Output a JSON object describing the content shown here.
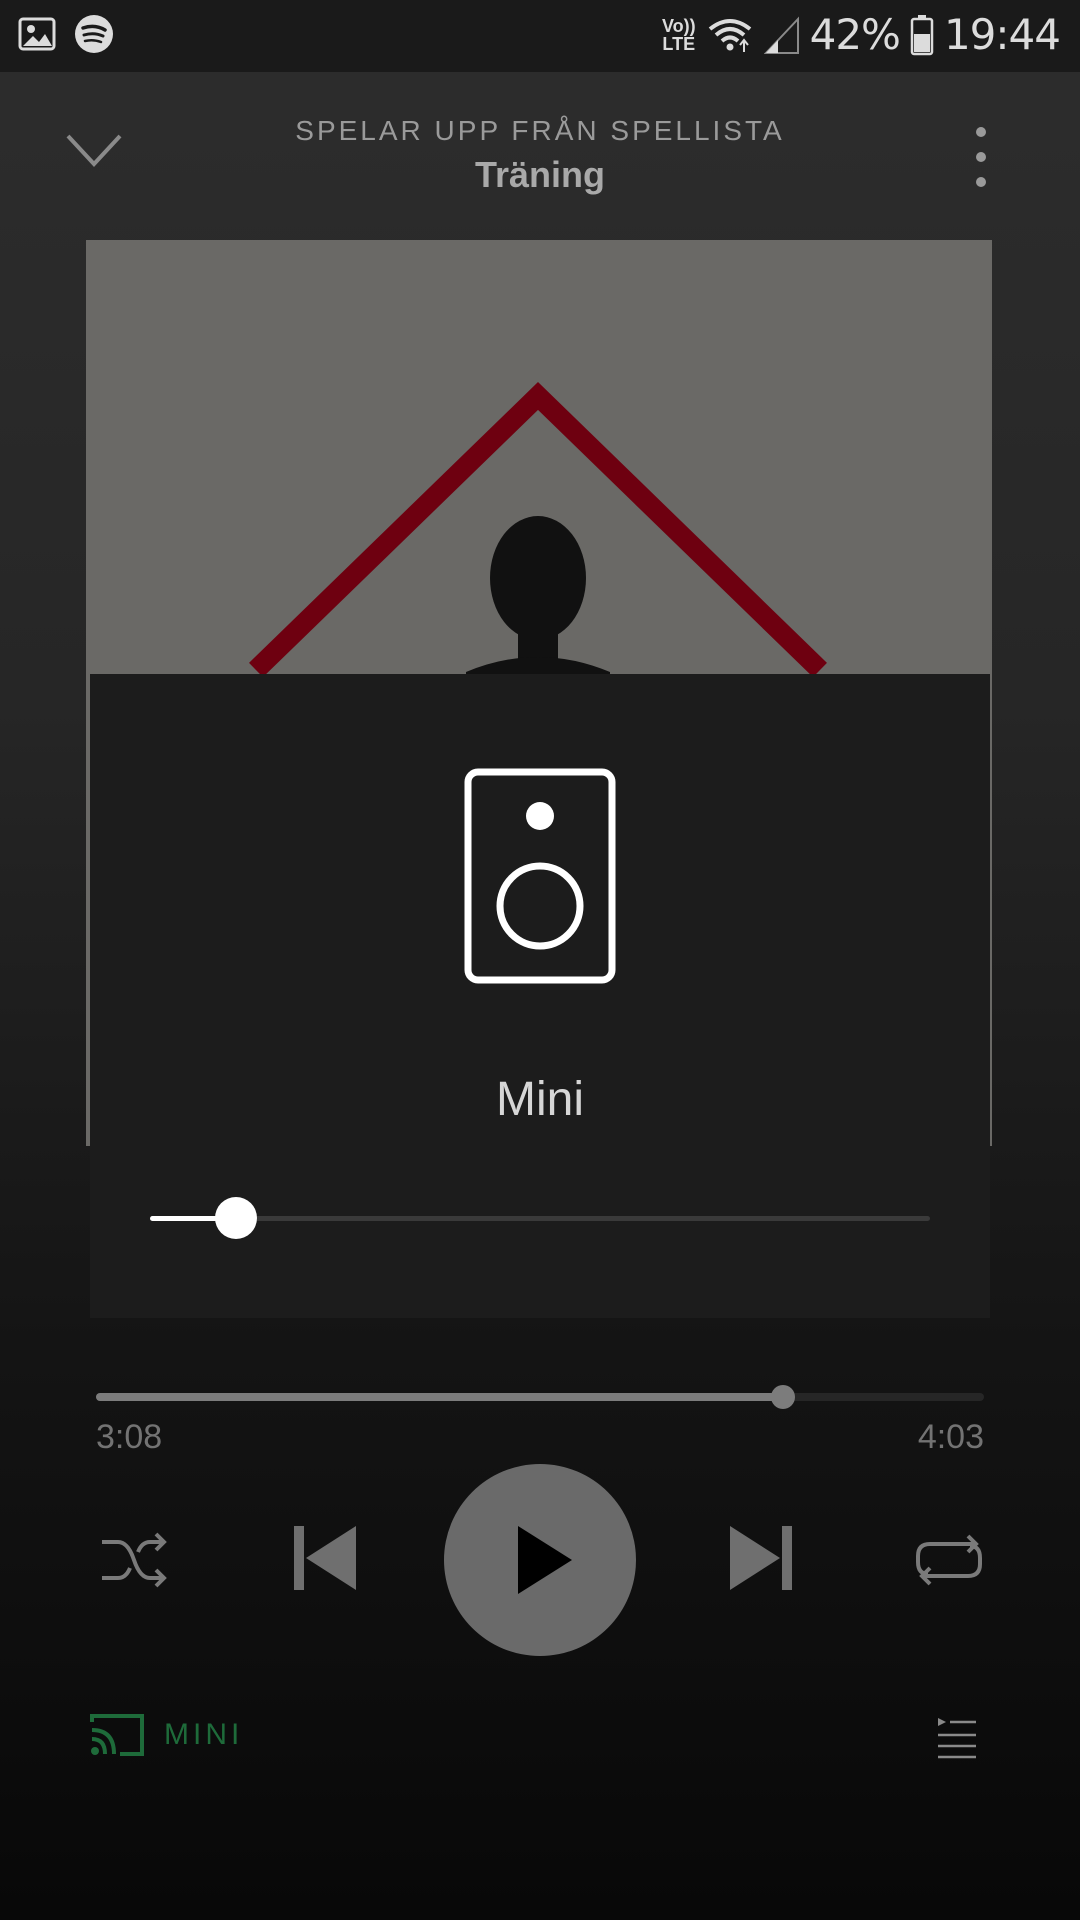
{
  "status_bar": {
    "battery": "42%",
    "time": "19:44",
    "volte_line1": "Vo))",
    "volte_line2": "LTE",
    "icons": [
      "image-icon",
      "spotify-icon",
      "volte-icon",
      "wifi-icon",
      "signal-icon",
      "battery-icon"
    ]
  },
  "header": {
    "context_label": "SPELAR UPP FRÅN SPELLISTA",
    "playlist_name": "Träning"
  },
  "device_popup": {
    "device_name": "Mini",
    "volume": 0.11
  },
  "playback": {
    "elapsed": "3:08",
    "total": "4:03",
    "progress": 0.774
  },
  "bottom": {
    "connected_device_label": "MINI"
  },
  "colors": {
    "accent_green": "#1e6b3a",
    "album_red": "#6e0010",
    "album_bg": "#6a6966"
  }
}
